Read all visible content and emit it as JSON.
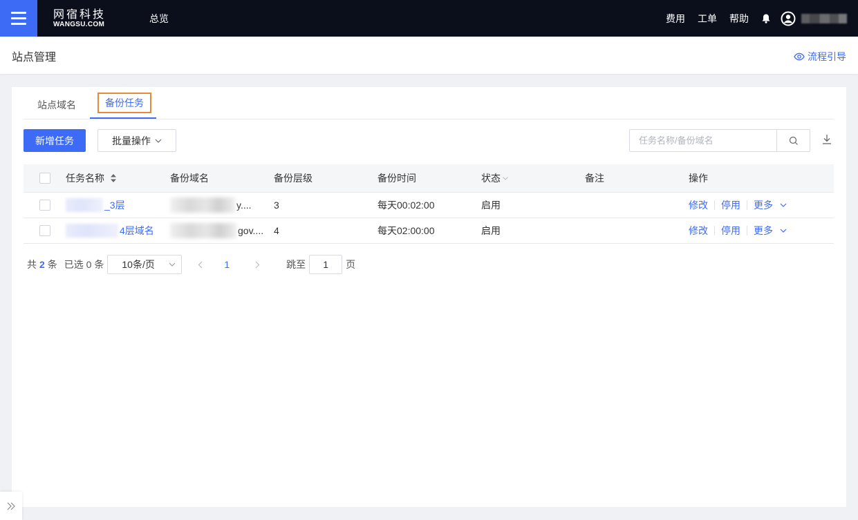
{
  "topbar": {
    "logo_cn": "网宿科技",
    "logo_en": "WANGSU.COM",
    "nav_overview": "总览",
    "links": [
      "费用",
      "工单",
      "帮助"
    ]
  },
  "page": {
    "title": "站点管理",
    "flow_guide": "流程引导"
  },
  "tabs": [
    "站点域名",
    "备份任务"
  ],
  "toolbar": {
    "add_task": "新增任务",
    "batch_ops": "批量操作",
    "search_placeholder": "任务名称/备份域名"
  },
  "table": {
    "columns": [
      "任务名称",
      "备份域名",
      "备份层级",
      "备份时间",
      "状态",
      "备注",
      "操作"
    ],
    "rows": [
      {
        "name": "_3层",
        "domain": "y....",
        "level": "3",
        "time": "每天00:02:00",
        "status": "启用",
        "note": ""
      },
      {
        "name": "4层域名",
        "domain": "gov....",
        "level": "4",
        "time": "每天02:00:00",
        "status": "启用",
        "note": ""
      }
    ],
    "actions": {
      "edit": "修改",
      "disable": "停用",
      "more": "更多"
    }
  },
  "pagination": {
    "total_prefix": "共",
    "total": "2",
    "total_suffix": "条",
    "selected": "已选 0 条",
    "page_size": "10条/页",
    "current_page": "1",
    "jump_label": "跳至",
    "jump_value": "1",
    "page_unit": "页"
  },
  "colors": {
    "primary": "#3d6bf5",
    "topbar": "#0b0f1c",
    "tab_highlight": "#e68a3a"
  }
}
